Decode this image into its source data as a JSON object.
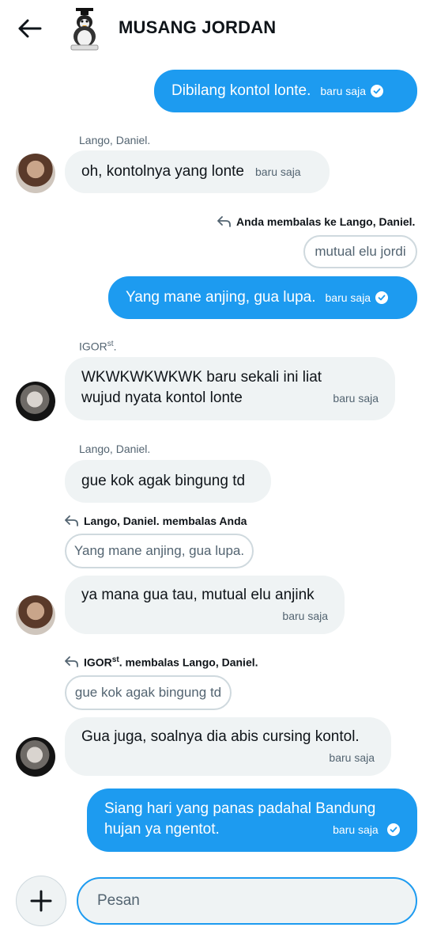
{
  "header": {
    "title": "MUSANG JORDAN",
    "back_icon": "arrow-left-icon",
    "group_avatar": "penguin-avatar"
  },
  "colors": {
    "accent": "#1d9bf0",
    "incoming_bubble": "#eff3f4",
    "secondary_text": "#536471"
  },
  "messages": [
    {
      "type": "out",
      "text": "Dibilang kontol lonte.",
      "time": "baru saja"
    },
    {
      "type": "in",
      "sender": "Lango, Daniel.",
      "text": "oh, kontolnya yang lonte",
      "time": "baru saja"
    },
    {
      "type": "reply-out",
      "reply_info": "Anda membalas ke Lango, Daniel.",
      "quote": "mutual elu jordi",
      "text": "Yang mane anjing, gua lupa.",
      "time": "baru saja"
    },
    {
      "type": "in",
      "sender": "IGOR",
      "sender_sup": "st",
      "sender_suffix": ".",
      "text_line1": "WKWKWKWKWK baru sekali ini liat",
      "text_line2": "wujud nyata kontol lonte",
      "time": "baru saja"
    },
    {
      "type": "in",
      "sender": "Lango, Daniel.",
      "text": "gue kok agak bingung td"
    },
    {
      "type": "reply-in",
      "reply_info": "Lango, Daniel. membalas Anda",
      "quote": "Yang mane anjing, gua lupa.",
      "text": "ya mana gua tau, mutual elu anjink",
      "time": "baru saja"
    },
    {
      "type": "reply-in",
      "reply_info_name": "IGOR",
      "reply_info_sup": "st",
      "reply_info_rest": ". membalas Lango, Daniel.",
      "quote": "gue kok agak bingung td",
      "text": "Gua juga, soalnya dia abis cursing kontol.",
      "time": "baru saja"
    },
    {
      "type": "out",
      "text_line1": "Siang hari yang panas padahal Bandung",
      "text_line2": "hujan ya ngentot.",
      "time": "baru saja"
    }
  ],
  "composer": {
    "placeholder": "Pesan",
    "add_icon": "plus-icon"
  }
}
